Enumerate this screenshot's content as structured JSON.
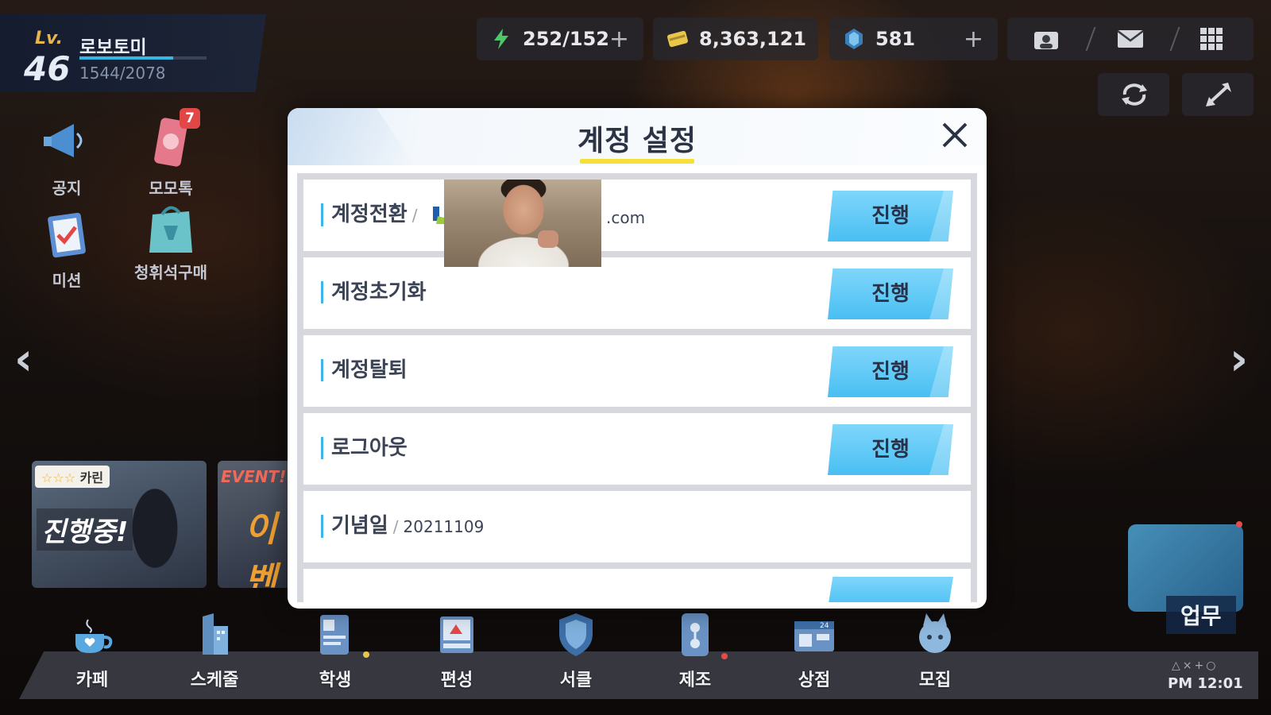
{
  "player": {
    "level_tag": "Lv.",
    "level": "46",
    "name": "로보토미",
    "exp": "1544/2078",
    "exp_progress": 0.74
  },
  "currencies": [
    {
      "icon": "lightning-icon",
      "value": "252/152",
      "has_plus": true
    },
    {
      "icon": "credit-card-icon",
      "value": "8,363,121",
      "has_plus": false
    },
    {
      "icon": "crystal-gem-icon",
      "value": "581",
      "has_plus": true
    }
  ],
  "top_buttons": [
    "profile-icon",
    "mail-icon",
    "menu-grid-icon"
  ],
  "secondary_buttons": [
    "refresh-icon",
    "expand-icon"
  ],
  "side_icons": [
    {
      "label": "공지",
      "icon": "megaphone-icon"
    },
    {
      "label": "모모톡",
      "icon": "phone-chat-icon",
      "badge": "7"
    },
    {
      "label": "미션",
      "icon": "clipboard-check-icon"
    },
    {
      "label": "청휘석구매",
      "icon": "shopping-bag-icon"
    }
  ],
  "banners": [
    {
      "stars": "☆☆☆",
      "name": "카린",
      "text": "진행중!"
    },
    {
      "text": "EVENT!",
      "sub": "이벤"
    }
  ],
  "bottom_nav": [
    {
      "label": "카페",
      "icon": "cafe-cup-icon"
    },
    {
      "label": "스케줄",
      "icon": "schedule-building-icon"
    },
    {
      "label": "학생",
      "icon": "student-card-icon"
    },
    {
      "label": "편성",
      "icon": "formation-board-icon"
    },
    {
      "label": "서클",
      "icon": "circle-shield-icon"
    },
    {
      "label": "제조",
      "icon": "crafting-icon"
    },
    {
      "label": "상점",
      "icon": "shop-icon"
    },
    {
      "label": "모집",
      "icon": "recruit-icon"
    }
  ],
  "work_label": "업무",
  "clock": "PM 12:01",
  "clock_symbols": "△×+○",
  "modal": {
    "title": "계정 설정",
    "rows": [
      {
        "label": "계정전환",
        "email_tail": ".com",
        "button": "진행"
      },
      {
        "label": "계정초기화",
        "button": "진행"
      },
      {
        "label": "계정탈퇴",
        "button": "진행"
      },
      {
        "label": "로그아웃",
        "button": "진행"
      },
      {
        "label": "기념일",
        "value": "20211109"
      }
    ]
  },
  "colors": {
    "accent": "#49bff2",
    "title_underline": "#f5e03a",
    "label_bar": "#3fb5ea",
    "badge": "#e24747"
  }
}
